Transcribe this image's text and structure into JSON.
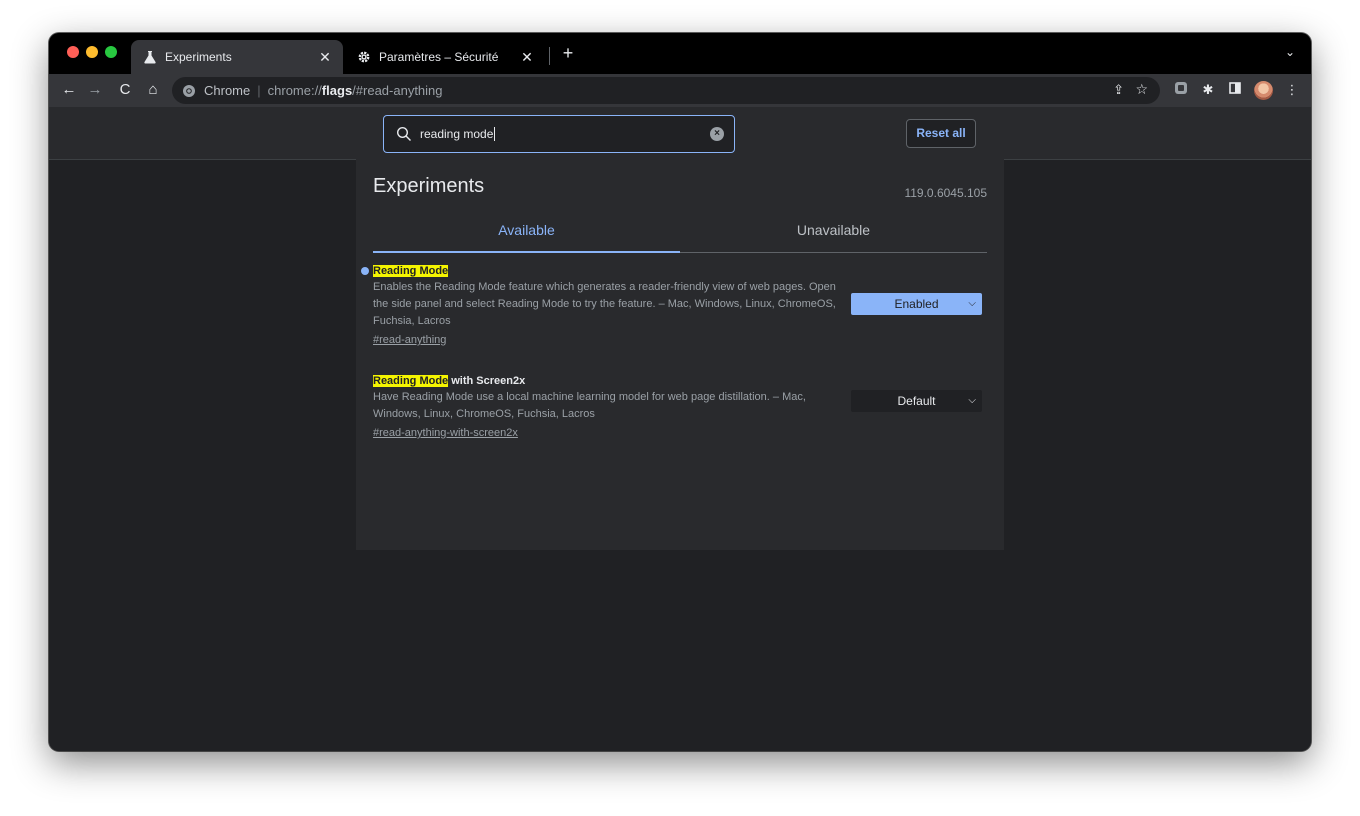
{
  "tabs": [
    {
      "title": "Experiments",
      "icon": "flask-icon",
      "active": true
    },
    {
      "title": "Paramètres – Sécurité",
      "icon": "gear-icon",
      "active": false
    }
  ],
  "toolbar": {
    "omnibox_chip": "Chrome",
    "url_scheme": "chrome://",
    "url_host": "flags",
    "url_path": "/#read-anything"
  },
  "search": {
    "value": "reading mode",
    "placeholder": "Search flags"
  },
  "header": {
    "reset_label": "Reset all"
  },
  "page": {
    "title": "Experiments",
    "version": "119.0.6045.105",
    "tab_available": "Available",
    "tab_unavailable": "Unavailable"
  },
  "flags": [
    {
      "name_highlight": "Reading Mode",
      "name_rest": "",
      "description": "Enables the Reading Mode feature which generates a reader-friendly view of web pages. Open the side panel and select Reading Mode to try the feature. – Mac, Windows, Linux, ChromeOS, Fuchsia, Lacros",
      "link": "#read-anything",
      "value": "Enabled",
      "modified": true
    },
    {
      "name_highlight": "Reading Mode",
      "name_rest": " with Screen2x",
      "description": "Have Reading Mode use a local machine learning model for web page distillation. – Mac, Windows, Linux, ChromeOS, Fuchsia, Lacros",
      "link": "#read-anything-with-screen2x",
      "value": "Default",
      "modified": false
    }
  ],
  "colors": {
    "accent": "#8ab4f8",
    "highlight": "#f5f500",
    "background": "#202124"
  }
}
